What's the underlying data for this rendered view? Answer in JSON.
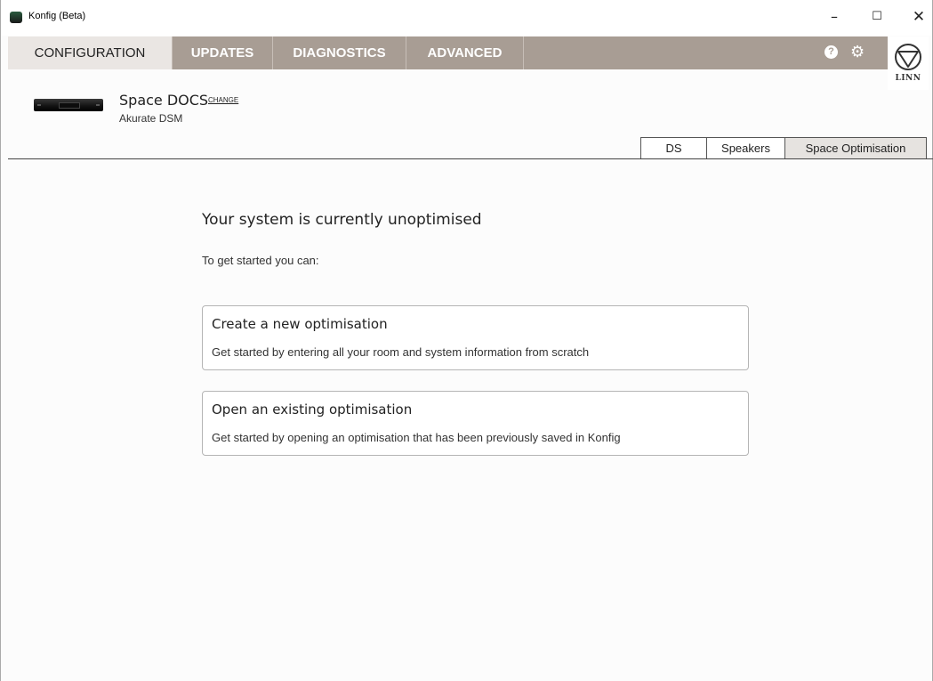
{
  "window": {
    "title": "Konfig (Beta)",
    "minimize": "–",
    "maximize": "☐",
    "close": "✕"
  },
  "nav": {
    "tabs": [
      {
        "label": "CONFIGURATION",
        "active": true
      },
      {
        "label": "UPDATES",
        "active": false
      },
      {
        "label": "DIAGNOSTICS",
        "active": false
      },
      {
        "label": "ADVANCED",
        "active": false
      }
    ],
    "help_icon": "?",
    "settings_icon": "gear-icon",
    "logo_text": "LINN"
  },
  "device": {
    "name": "Space DOCS",
    "change_label": "CHANGE",
    "model": "Akurate DSM"
  },
  "subtabs": [
    {
      "label": "DS",
      "active": false
    },
    {
      "label": "Speakers",
      "active": false
    },
    {
      "label": "Space Optimisation",
      "active": true
    }
  ],
  "content": {
    "heading": "Your system is currently unoptimised",
    "subheading": "To get started you can:",
    "options": [
      {
        "title": "Create a new optimisation",
        "description": "Get started by entering all your room and system information from scratch"
      },
      {
        "title": "Open an existing optimisation",
        "description": "Get started by opening an optimisation that has been previously saved in Konfig"
      }
    ]
  },
  "colors": {
    "nav_bg": "#a89d94",
    "nav_active_bg": "#eae6e3",
    "subtab_active_bg": "#e6e3e0"
  }
}
